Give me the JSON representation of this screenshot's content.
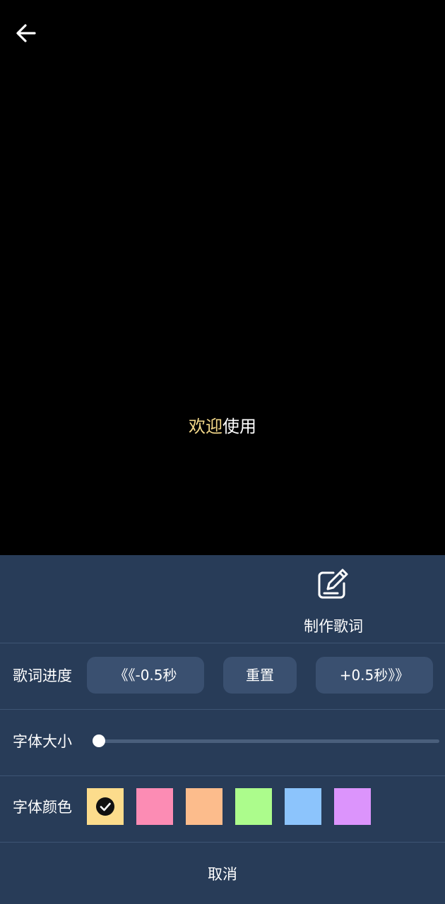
{
  "preview": {
    "lyric_highlight": "欢迎",
    "lyric_rest": "使用",
    "highlight_color": "#f4d98a"
  },
  "panel": {
    "bg_color": "#283c58",
    "make_lyrics_label": "制作歌词",
    "progress": {
      "label": "歌词进度",
      "minus_label": "《《-0.5秒",
      "reset_label": "重置",
      "plus_label": "+0.5秒》》"
    },
    "font_size": {
      "label": "字体大小",
      "value_fraction": 0.0
    },
    "font_color": {
      "label": "字体颜色",
      "selected_index": 0,
      "swatches": [
        "#fcdc8c",
        "#fc8cb4",
        "#fcbc8c",
        "#acfc8c",
        "#8cc4fc",
        "#dc94fc"
      ]
    },
    "cancel_label": "取消"
  },
  "icons": {
    "back": "arrow-left-icon",
    "make_lyrics": "edit-icon",
    "selected": "check-circle-icon"
  }
}
